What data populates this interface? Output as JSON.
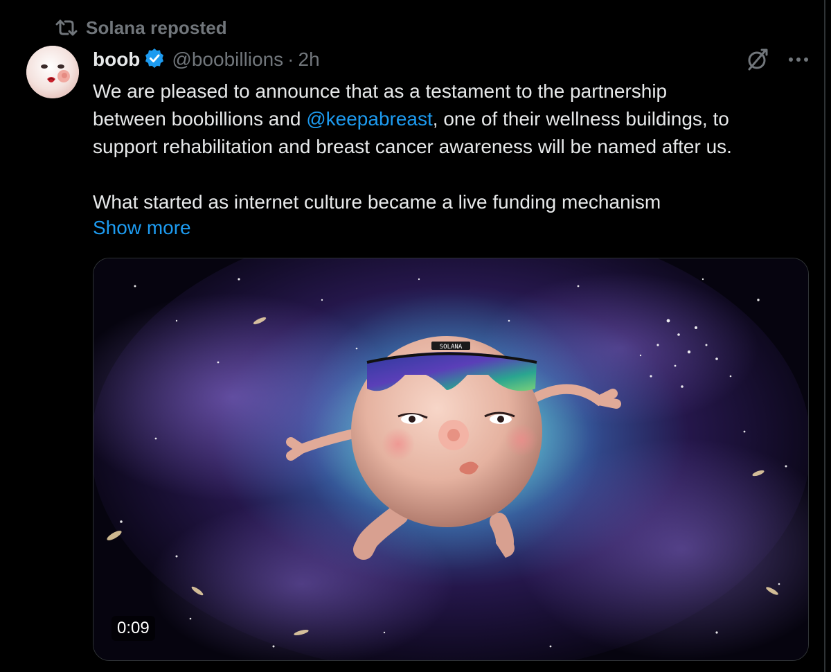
{
  "repost": {
    "label": "Solana reposted",
    "icon": "repost-icon"
  },
  "tweet": {
    "display_name": "boob",
    "verified": true,
    "handle": "@boobillions",
    "separator": "·",
    "time": "2h",
    "avatar_icon": "avatar-face",
    "text": {
      "line1": "We are pleased to announce that as a testament to the partnership",
      "line2_prefix": "between boobillions and ",
      "mention": "@keepabreast",
      "line2_suffix": ", one of their wellness buildings, to",
      "line3": "support rehabilitation and breast cancer awareness will be named after us.",
      "line4": "What started as internet culture became a live funding mechanism"
    },
    "show_more": "Show more",
    "actions": {
      "grok_icon": "grok-icon",
      "more_icon": "more-icon"
    },
    "media": {
      "type": "video",
      "duration": "0:09",
      "glasses_brand": "SOLANA"
    }
  },
  "colors": {
    "background": "#000000",
    "text": "#e7e9ea",
    "muted": "#71767b",
    "accent": "#1d9bf0",
    "border": "#2f3336"
  }
}
